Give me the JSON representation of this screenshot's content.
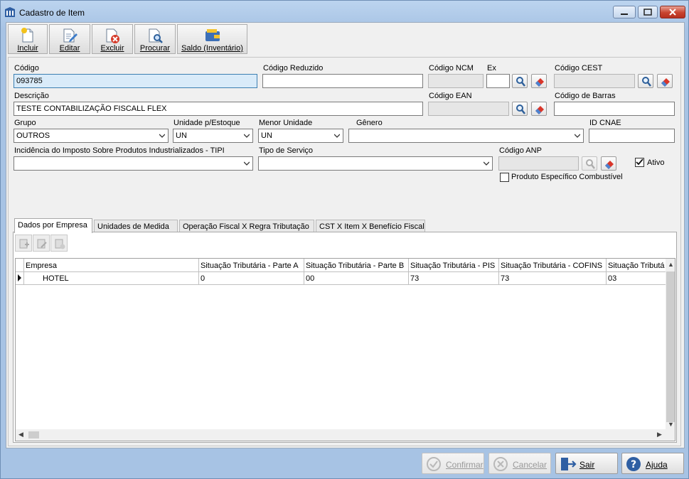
{
  "window": {
    "title": "Cadastro de Item"
  },
  "toolbar": {
    "incluir": "Incluir",
    "editar": "Editar",
    "excluir": "Excluir",
    "procurar": "Procurar",
    "saldo": "Saldo (Inventário)"
  },
  "form": {
    "codigo": {
      "label": "Código",
      "value": "093785"
    },
    "codigo_reduzido": {
      "label": "Código Reduzido",
      "value": ""
    },
    "codigo_ncm": {
      "label": "Código NCM",
      "value": ""
    },
    "ex": {
      "label": "Ex",
      "value": ""
    },
    "codigo_cest": {
      "label": "Código CEST",
      "value": ""
    },
    "descricao": {
      "label": "Descrição",
      "value": "TESTE CONTABILIZAÇÃO FISCALL FLEX"
    },
    "codigo_ean": {
      "label": "Código EAN",
      "value": ""
    },
    "codigo_barras": {
      "label": "Código de Barras",
      "value": ""
    },
    "grupo": {
      "label": "Grupo",
      "value": "OUTROS"
    },
    "unidade_estoque": {
      "label": "Unidade p/Estoque",
      "value": "UN"
    },
    "menor_unidade": {
      "label": "Menor Unidade",
      "value": "UN"
    },
    "genero": {
      "label": "Gênero",
      "value": ""
    },
    "id_cnae": {
      "label": "ID CNAE",
      "value": ""
    },
    "tipi": {
      "label": "Incidência do Imposto Sobre Produtos Industrializados - TIPI",
      "value": ""
    },
    "tipo_servico": {
      "label": "Tipo de Serviço",
      "value": ""
    },
    "codigo_anp": {
      "label": "Código ANP",
      "value": ""
    },
    "ativo": {
      "label": "Ativo",
      "checked": true
    },
    "produto_combustivel": {
      "label": "Produto Específico Combustível",
      "checked": false
    }
  },
  "tabs": [
    {
      "label": "Dados por Empresa",
      "active": true
    },
    {
      "label": "Unidades de Medida",
      "active": false
    },
    {
      "label": "Operação Fiscal X Regra Tributação",
      "active": false
    },
    {
      "label": "CST X Item X Benefício Fiscal",
      "active": false
    }
  ],
  "grid": {
    "columns": [
      "Empresa",
      "Situação Tributária - Parte A",
      "Situação Tributária - Parte B",
      "Situação Tributária - PIS",
      "Situação Tributária - COFINS",
      "Situação Tributá"
    ],
    "rows": [
      [
        "HOTEL",
        "0",
        "00",
        "73",
        "73",
        "03"
      ]
    ]
  },
  "footer": {
    "confirmar": "Confirmar",
    "cancelar": "Cancelar",
    "sair": "Sair",
    "ajuda": "Ajuda"
  },
  "colors": {
    "title_bg": "#bcd4ef",
    "focus_field": "#d9ebf9",
    "close_button": "#c8432f"
  }
}
